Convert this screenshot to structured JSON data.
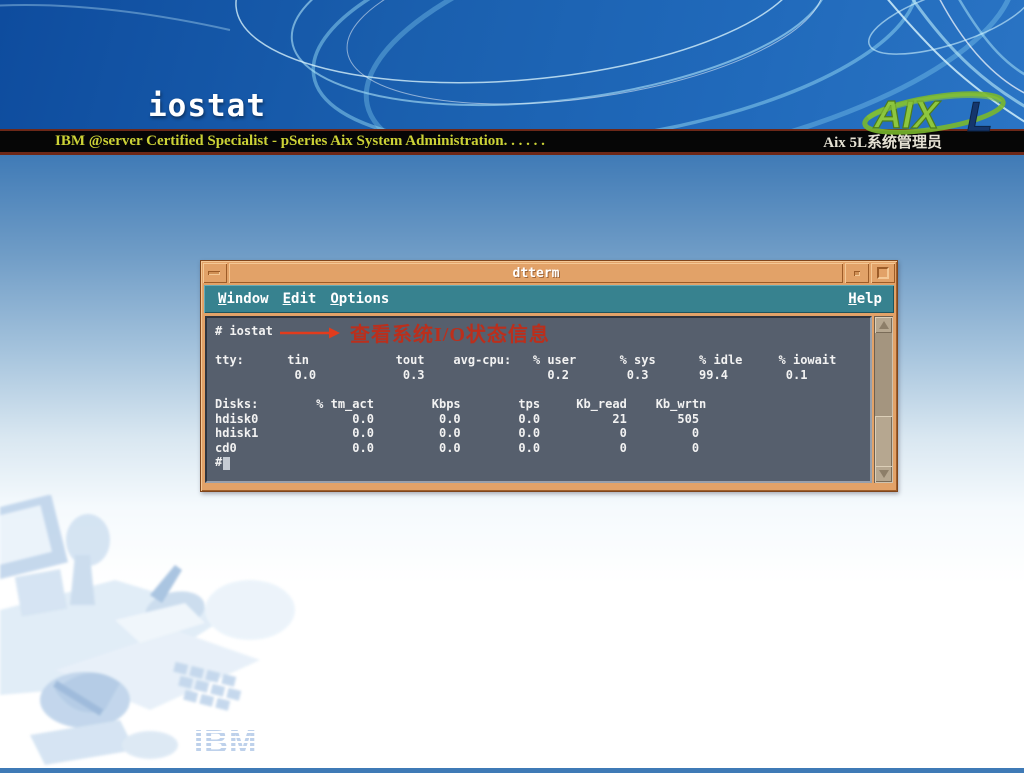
{
  "slide": {
    "title": "iostat",
    "header_bar": {
      "left": "IBM @server Certified Specialist - pSeries Aix System Administration. . . . . .",
      "right": "Aix 5L系统管理员"
    },
    "aix_logo": {
      "main": "AIX",
      "suffix": "L"
    },
    "ibm_logo_text": "IBM"
  },
  "terminal": {
    "title": "dtterm",
    "menu_items": [
      "Window",
      "Edit",
      "Options"
    ],
    "help_label": "Help",
    "annotation": {
      "text": "查看系统I/O状态信息"
    },
    "screen_lines": [
      "# iostat",
      "",
      "tty:      tin            tout    avg-cpu:   % user      % sys      % idle     % iowait",
      "           0.0            0.3                 0.2        0.3       99.4        0.1",
      "",
      "Disks:        % tm_act        Kbps        tps     Kb_read    Kb_wrtn",
      "hdisk0             0.0         0.0        0.0          21       505",
      "hdisk1             0.0         0.0        0.0           0         0",
      "cd0                0.0         0.0        0.0           0         0",
      "#"
    ],
    "iostat_table": {
      "tty": {
        "tin": 0.0,
        "tout": 0.3
      },
      "avg_cpu": {
        "user_pct": 0.2,
        "sys_pct": 0.3,
        "idle_pct": 99.4,
        "iowait_pct": 0.1
      },
      "disks_headers": [
        "Disks:",
        "% tm_act",
        "Kbps",
        "tps",
        "Kb_read",
        "Kb_wrtn"
      ],
      "disks_rows": [
        [
          "hdisk0",
          "0.0",
          "0.0",
          "0.0",
          "21",
          "505"
        ],
        [
          "hdisk1",
          "0.0",
          "0.0",
          "0.0",
          "0",
          "0"
        ],
        [
          "cd0",
          "0.0",
          "0.0",
          "0.0",
          "0",
          "0"
        ]
      ]
    }
  },
  "colors": {
    "banner_blue": "#1a5fae",
    "titlebar_orange": "#e2a268",
    "menubar_teal": "#37828f",
    "screen_bg": "#565f6d",
    "annotation_red": "#bb2f1c",
    "header_text_yellow": "#ccd236",
    "aix_green": "#8dc73f",
    "ibm_logo_blue": "#b7cde9"
  }
}
